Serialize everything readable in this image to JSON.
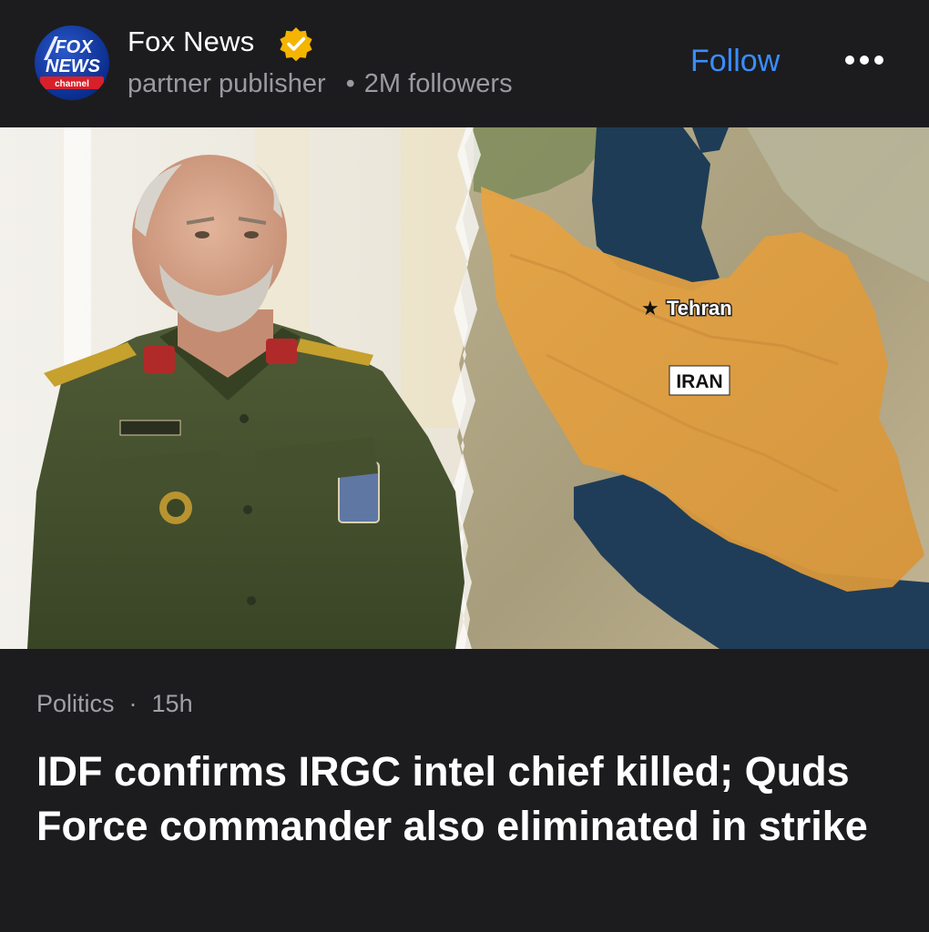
{
  "publisher": {
    "name": "Fox News",
    "logo_text_top": "FOX",
    "logo_text_bottom": "NEWS",
    "logo_text_channel": "channel",
    "subtitle": "partner publisher",
    "separator": "•",
    "followers": "2M followers",
    "verified_icon": "verified-badge-icon",
    "verified_color": "#f5b400"
  },
  "actions": {
    "follow_label": "Follow",
    "follow_color": "#3a8dff",
    "more_icon": "more-horizontal-icon"
  },
  "hero": {
    "map_labels": {
      "city": "Tehran",
      "country": "IRAN"
    },
    "highlight_color": "#e0a040"
  },
  "article": {
    "category": "Politics",
    "separator": "·",
    "age": "15h",
    "headline": "IDF confirms IRGC intel chief killed; Quds Force commander also eliminated in strike"
  }
}
